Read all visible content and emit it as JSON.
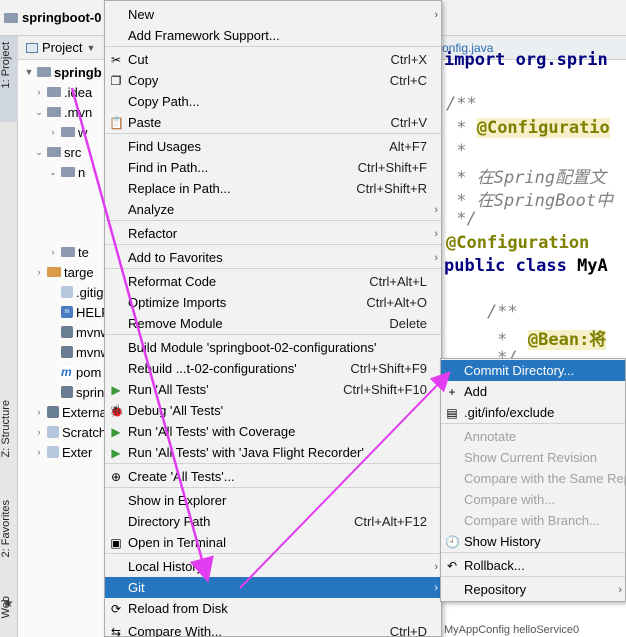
{
  "titlebar": {
    "project_name": "springboot-0"
  },
  "tool_stripe": {
    "project": "1: Project",
    "structure": "Z: Structure",
    "favorites": "2: Favorites",
    "web": "Web"
  },
  "panel": {
    "header": "Project",
    "tree": [
      {
        "label": "springb",
        "bold": true
      },
      {
        "label": ".idea"
      },
      {
        "label": ".mvn"
      },
      {
        "label": "w"
      },
      {
        "label": "src"
      },
      {
        "label": "n"
      },
      {
        "label": "te"
      },
      {
        "label": "targe"
      },
      {
        "label": ".gitig"
      },
      {
        "label": "HELP"
      },
      {
        "label": "mvnw"
      },
      {
        "label": "mvnw"
      },
      {
        "label": "pom"
      },
      {
        "label": "sprin"
      },
      {
        "label": "External"
      },
      {
        "label": "Scratche"
      },
      {
        "label": "Exter"
      }
    ]
  },
  "editor": {
    "tab": "onfig.java",
    "bottom_tabs": "MyAppConfig    helloService0",
    "lines": {
      "l1": "import org.sprin",
      "l2": "/**",
      "l3a": " * ",
      "l3b": "@Configuratio",
      "l4": " *",
      "l5": " * 在Spring配置文",
      "l6": " * 在SpringBoot中",
      "l7": " */",
      "l8": "@Configuration",
      "l9a": "public class",
      "l9b": " MyA",
      "l10": "    /**",
      "l11a": "     *  ",
      "l11b": "@Bean:将",
      "l12": "     */"
    }
  },
  "context_menu": {
    "items": [
      {
        "label": "New",
        "submenu": true
      },
      {
        "label": "Add Framework Support..."
      },
      {
        "label": "Cut",
        "shortcut": "Ctrl+X",
        "icon": "scissors-icon"
      },
      {
        "label": "Copy",
        "shortcut": "Ctrl+C",
        "icon": "copy-icon"
      },
      {
        "label": "Copy Path..."
      },
      {
        "label": "Paste",
        "shortcut": "Ctrl+V",
        "icon": "paste-icon"
      },
      {
        "label": "Find Usages",
        "shortcut": "Alt+F7"
      },
      {
        "label": "Find in Path...",
        "shortcut": "Ctrl+Shift+F"
      },
      {
        "label": "Replace in Path...",
        "shortcut": "Ctrl+Shift+R"
      },
      {
        "label": "Analyze",
        "submenu": true
      },
      {
        "label": "Refactor",
        "submenu": true
      },
      {
        "label": "Add to Favorites",
        "submenu": true
      },
      {
        "label": "Reformat Code",
        "shortcut": "Ctrl+Alt+L"
      },
      {
        "label": "Optimize Imports",
        "shortcut": "Ctrl+Alt+O"
      },
      {
        "label": "Remove Module",
        "shortcut": "Delete"
      },
      {
        "label": "Build Module 'springboot-02-configurations'"
      },
      {
        "label": "Rebuild ...t-02-configurations'",
        "shortcut": "Ctrl+Shift+F9"
      },
      {
        "label": "Run 'All Tests'",
        "shortcut": "Ctrl+Shift+F10",
        "icon": "run-icon"
      },
      {
        "label": "Debug 'All Tests'",
        "icon": "debug-icon"
      },
      {
        "label": "Run 'All Tests' with Coverage",
        "icon": "coverage-icon"
      },
      {
        "label": "Run 'All Tests' with 'Java Flight Recorder'",
        "icon": "profiler-icon"
      },
      {
        "label": "Create 'All Tests'...",
        "icon": "create-test-icon"
      },
      {
        "label": "Show in Explorer"
      },
      {
        "label": "Directory Path",
        "shortcut": "Ctrl+Alt+F12"
      },
      {
        "label": "Open in Terminal",
        "icon": "terminal-icon"
      },
      {
        "label": "Local History",
        "submenu": true
      },
      {
        "label": "Git",
        "submenu": true,
        "selected": true
      },
      {
        "label": "Reload from Disk",
        "icon": "reload-icon"
      },
      {
        "label": "Compare With...",
        "shortcut": "Ctrl+D",
        "icon": "compare-icon"
      }
    ]
  },
  "git_submenu": {
    "items": [
      {
        "label": "Commit Directory...",
        "selected": true
      },
      {
        "label": "Add",
        "icon": "plus-icon"
      },
      {
        "label": ".git/info/exclude",
        "icon": "exclude-file-icon"
      },
      {
        "label": "Annotate",
        "disabled": true
      },
      {
        "label": "Show Current Revision",
        "disabled": true
      },
      {
        "label": "Compare with the Same Rep",
        "disabled": true
      },
      {
        "label": "Compare with...",
        "disabled": true
      },
      {
        "label": "Compare with Branch...",
        "disabled": true
      },
      {
        "label": "Show History",
        "icon": "history-icon"
      },
      {
        "label": "Rollback...",
        "icon": "rollback-icon"
      },
      {
        "label": "Repository",
        "submenu": true
      }
    ]
  },
  "colors": {
    "selection": "#2675bf",
    "annotation_arrow": "#e23cf0",
    "keyword": "#000080"
  }
}
